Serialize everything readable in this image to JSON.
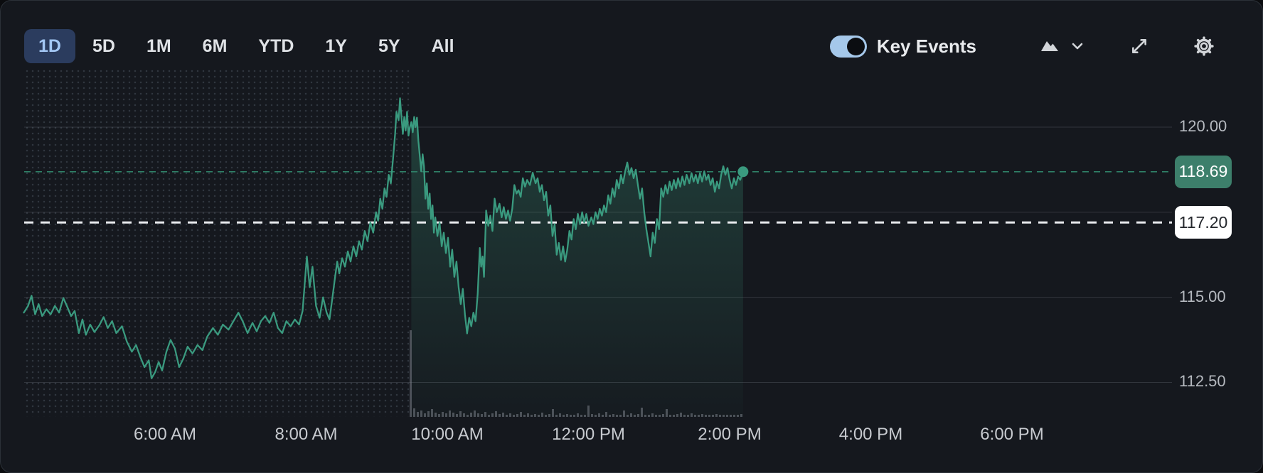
{
  "toolbar": {
    "ranges": [
      "1D",
      "5D",
      "1M",
      "6M",
      "YTD",
      "1Y",
      "5Y",
      "All"
    ],
    "active_range": "1D",
    "active_index": 0
  },
  "controls": {
    "key_events_label": "Key Events",
    "key_events_on": true,
    "icons": {
      "chart_type": "area-chart-icon",
      "chart_type_menu": "chevron-down-icon",
      "fullscreen": "expand-icon",
      "settings": "gear-icon"
    }
  },
  "colors": {
    "background": "#15181e",
    "line_green": "#3a9a7f",
    "current_badge_green": "#3d7f6b",
    "prev_close_badge": "#ffffff",
    "tab_active_bg": "#2b3c5e",
    "tab_active_text": "#a3c7f4",
    "toggle_blue": "#a5c8ea"
  },
  "chart_data": {
    "type": "line",
    "title": "Intraday price chart (1D) with pre-market session",
    "xlabel": "",
    "ylabel": "",
    "x_ticks": [
      {
        "t": 6,
        "label": "6:00 AM"
      },
      {
        "t": 8,
        "label": "8:00 AM"
      },
      {
        "t": 10,
        "label": "10:00 AM"
      },
      {
        "t": 12,
        "label": "12:00 PM"
      },
      {
        "t": 14,
        "label": "2:00 PM"
      },
      {
        "t": 16,
        "label": "4:00 PM"
      },
      {
        "t": 18,
        "label": "6:00 PM"
      }
    ],
    "y_ticks": [
      {
        "v": 120,
        "label": "120.00"
      },
      {
        "v": 115,
        "label": "115.00"
      },
      {
        "v": 112.5,
        "label": "112.50"
      }
    ],
    "gridlines": [
      120,
      117.5,
      115,
      112.5
    ],
    "ylim": [
      111.9,
      121.5
    ],
    "xlim_hours": [
      4.0,
      18.6
    ],
    "session_open_t": 9.5,
    "current_price": 118.69,
    "current_price_label": "118.69",
    "prev_close": 117.2,
    "prev_close_label": "117.20",
    "series": [
      [
        4.0,
        114.55
      ],
      [
        4.06,
        114.75
      ],
      [
        4.11,
        115.05
      ],
      [
        4.16,
        114.5
      ],
      [
        4.21,
        114.8
      ],
      [
        4.26,
        114.45
      ],
      [
        4.32,
        114.65
      ],
      [
        4.38,
        114.5
      ],
      [
        4.44,
        114.75
      ],
      [
        4.5,
        114.55
      ],
      [
        4.56,
        114.98
      ],
      [
        4.62,
        114.7
      ],
      [
        4.67,
        114.45
      ],
      [
        4.72,
        114.6
      ],
      [
        4.78,
        113.95
      ],
      [
        4.83,
        114.35
      ],
      [
        4.88,
        113.9
      ],
      [
        4.94,
        114.2
      ],
      [
        5.0,
        113.98
      ],
      [
        5.07,
        114.18
      ],
      [
        5.13,
        114.42
      ],
      [
        5.19,
        114.1
      ],
      [
        5.25,
        114.3
      ],
      [
        5.31,
        113.95
      ],
      [
        5.39,
        114.15
      ],
      [
        5.46,
        113.7
      ],
      [
        5.53,
        113.4
      ],
      [
        5.59,
        113.6
      ],
      [
        5.65,
        113.25
      ],
      [
        5.71,
        112.95
      ],
      [
        5.77,
        113.15
      ],
      [
        5.81,
        112.62
      ],
      [
        5.86,
        112.8
      ],
      [
        5.91,
        113.1
      ],
      [
        5.96,
        112.85
      ],
      [
        6.02,
        113.4
      ],
      [
        6.08,
        113.75
      ],
      [
        6.14,
        113.5
      ],
      [
        6.2,
        112.95
      ],
      [
        6.26,
        113.2
      ],
      [
        6.32,
        113.55
      ],
      [
        6.39,
        113.35
      ],
      [
        6.46,
        113.6
      ],
      [
        6.53,
        113.45
      ],
      [
        6.6,
        113.85
      ],
      [
        6.68,
        114.1
      ],
      [
        6.75,
        113.9
      ],
      [
        6.82,
        114.2
      ],
      [
        6.9,
        114.05
      ],
      [
        6.97,
        114.3
      ],
      [
        7.04,
        114.55
      ],
      [
        7.1,
        114.3
      ],
      [
        7.17,
        113.95
      ],
      [
        7.24,
        114.25
      ],
      [
        7.3,
        114.0
      ],
      [
        7.36,
        114.3
      ],
      [
        7.42,
        114.45
      ],
      [
        7.48,
        114.25
      ],
      [
        7.54,
        114.55
      ],
      [
        7.6,
        114.1
      ],
      [
        7.66,
        113.95
      ],
      [
        7.72,
        114.3
      ],
      [
        7.78,
        114.15
      ],
      [
        7.84,
        114.35
      ],
      [
        7.9,
        114.2
      ],
      [
        7.95,
        114.6
      ],
      [
        8.01,
        116.2
      ],
      [
        8.05,
        115.3
      ],
      [
        8.09,
        115.9
      ],
      [
        8.14,
        114.75
      ],
      [
        8.19,
        114.4
      ],
      [
        8.24,
        115.0
      ],
      [
        8.29,
        114.55
      ],
      [
        8.33,
        114.35
      ],
      [
        8.37,
        114.95
      ],
      [
        8.41,
        115.6
      ],
      [
        8.44,
        116.05
      ],
      [
        8.47,
        115.7
      ],
      [
        8.51,
        116.15
      ],
      [
        8.55,
        115.9
      ],
      [
        8.59,
        116.35
      ],
      [
        8.63,
        116.05
      ],
      [
        8.67,
        116.5
      ],
      [
        8.71,
        116.2
      ],
      [
        8.75,
        116.65
      ],
      [
        8.79,
        116.4
      ],
      [
        8.83,
        116.95
      ],
      [
        8.87,
        116.65
      ],
      [
        8.91,
        117.2
      ],
      [
        8.95,
        116.9
      ],
      [
        8.99,
        117.5
      ],
      [
        9.02,
        117.25
      ],
      [
        9.05,
        117.9
      ],
      [
        9.08,
        117.6
      ],
      [
        9.11,
        118.2
      ],
      [
        9.14,
        117.95
      ],
      [
        9.17,
        118.6
      ],
      [
        9.2,
        118.35
      ],
      [
        9.23,
        119.05
      ],
      [
        9.26,
        119.8
      ],
      [
        9.28,
        120.45
      ],
      [
        9.31,
        120.2
      ],
      [
        9.33,
        120.85
      ],
      [
        9.35,
        120.3
      ],
      [
        9.37,
        119.8
      ],
      [
        9.39,
        120.3
      ],
      [
        9.41,
        119.9
      ],
      [
        9.43,
        120.45
      ],
      [
        9.45,
        119.75
      ],
      [
        9.47,
        120.0
      ],
      [
        9.49,
        120.15
      ],
      [
        9.51,
        119.85
      ],
      [
        9.53,
        120.3
      ],
      [
        9.55,
        120.0
      ],
      [
        9.57,
        120.28
      ],
      [
        9.59,
        119.6
      ],
      [
        9.61,
        119.15
      ],
      [
        9.63,
        118.7
      ],
      [
        9.65,
        119.2
      ],
      [
        9.67,
        118.85
      ],
      [
        9.69,
        117.9
      ],
      [
        9.71,
        118.35
      ],
      [
        9.73,
        117.6
      ],
      [
        9.75,
        118.05
      ],
      [
        9.77,
        117.3
      ],
      [
        9.79,
        117.7
      ],
      [
        9.81,
        116.9
      ],
      [
        9.83,
        117.35
      ],
      [
        9.86,
        116.8
      ],
      [
        9.89,
        117.2
      ],
      [
        9.92,
        116.5
      ],
      [
        9.95,
        116.9
      ],
      [
        9.98,
        116.3
      ],
      [
        10.01,
        116.75
      ],
      [
        10.04,
        115.9
      ],
      [
        10.07,
        116.4
      ],
      [
        10.1,
        115.6
      ],
      [
        10.13,
        116.05
      ],
      [
        10.16,
        115.3
      ],
      [
        10.19,
        114.8
      ],
      [
        10.22,
        115.25
      ],
      [
        10.25,
        114.5
      ],
      [
        10.28,
        113.94
      ],
      [
        10.31,
        114.4
      ],
      [
        10.34,
        114.15
      ],
      [
        10.37,
        114.55
      ],
      [
        10.4,
        114.3
      ],
      [
        10.43,
        115.1
      ],
      [
        10.46,
        116.45
      ],
      [
        10.48,
        115.9
      ],
      [
        10.5,
        116.2
      ],
      [
        10.52,
        115.6
      ],
      [
        10.55,
        117.55
      ],
      [
        10.58,
        117.1
      ],
      [
        10.61,
        117.4
      ],
      [
        10.64,
        116.95
      ],
      [
        10.67,
        117.9
      ],
      [
        10.7,
        117.5
      ],
      [
        10.74,
        117.75
      ],
      [
        10.77,
        117.35
      ],
      [
        10.8,
        117.65
      ],
      [
        10.83,
        117.3
      ],
      [
        10.86,
        117.55
      ],
      [
        10.89,
        117.25
      ],
      [
        10.92,
        117.6
      ],
      [
        10.95,
        118.3
      ],
      [
        10.98,
        118.05
      ],
      [
        11.01,
        118.15
      ],
      [
        11.04,
        117.95
      ],
      [
        11.07,
        118.5
      ],
      [
        11.1,
        118.25
      ],
      [
        11.13,
        118.45
      ],
      [
        11.17,
        118.3
      ],
      [
        11.21,
        118.66
      ],
      [
        11.25,
        118.35
      ],
      [
        11.28,
        118.5
      ],
      [
        11.31,
        118.1
      ],
      [
        11.34,
        118.3
      ],
      [
        11.37,
        117.85
      ],
      [
        11.4,
        118.1
      ],
      [
        11.43,
        117.4
      ],
      [
        11.46,
        117.7
      ],
      [
        11.49,
        116.8
      ],
      [
        11.52,
        117.15
      ],
      [
        11.55,
        116.25
      ],
      [
        11.58,
        116.6
      ],
      [
        11.61,
        116.1
      ],
      [
        11.64,
        116.5
      ],
      [
        11.67,
        116.05
      ],
      [
        11.7,
        116.4
      ],
      [
        11.73,
        116.95
      ],
      [
        11.76,
        116.7
      ],
      [
        11.79,
        117.3
      ],
      [
        11.82,
        117.0
      ],
      [
        11.85,
        117.45
      ],
      [
        11.88,
        117.15
      ],
      [
        11.91,
        117.5
      ],
      [
        11.94,
        117.2
      ],
      [
        11.97,
        117.45
      ],
      [
        12.0,
        117.1
      ],
      [
        12.04,
        117.35
      ],
      [
        12.07,
        117.15
      ],
      [
        12.1,
        117.5
      ],
      [
        12.13,
        117.3
      ],
      [
        12.16,
        117.6
      ],
      [
        12.19,
        117.4
      ],
      [
        12.22,
        117.7
      ],
      [
        12.25,
        117.5
      ],
      [
        12.28,
        118.0
      ],
      [
        12.31,
        117.75
      ],
      [
        12.34,
        118.2
      ],
      [
        12.37,
        117.95
      ],
      [
        12.4,
        118.45
      ],
      [
        12.43,
        118.2
      ],
      [
        12.46,
        118.6
      ],
      [
        12.49,
        118.35
      ],
      [
        12.52,
        118.7
      ],
      [
        12.55,
        118.96
      ],
      [
        12.58,
        118.6
      ],
      [
        12.61,
        118.8
      ],
      [
        12.64,
        118.5
      ],
      [
        12.67,
        118.75
      ],
      [
        12.7,
        118.3
      ],
      [
        12.73,
        117.9
      ],
      [
        12.76,
        118.2
      ],
      [
        12.79,
        117.5
      ],
      [
        12.82,
        117.0
      ],
      [
        12.85,
        116.6
      ],
      [
        12.88,
        116.2
      ],
      [
        12.91,
        116.9
      ],
      [
        12.94,
        116.6
      ],
      [
        12.97,
        117.3
      ],
      [
        13.0,
        117.0
      ],
      [
        13.03,
        118.2
      ],
      [
        13.06,
        117.95
      ],
      [
        13.09,
        118.3
      ],
      [
        13.12,
        118.05
      ],
      [
        13.15,
        118.4
      ],
      [
        13.18,
        118.15
      ],
      [
        13.21,
        118.45
      ],
      [
        13.24,
        118.2
      ],
      [
        13.27,
        118.5
      ],
      [
        13.3,
        118.25
      ],
      [
        13.33,
        118.55
      ],
      [
        13.36,
        118.3
      ],
      [
        13.39,
        118.6
      ],
      [
        13.43,
        118.35
      ],
      [
        13.46,
        118.65
      ],
      [
        13.49,
        118.4
      ],
      [
        13.52,
        118.6
      ],
      [
        13.55,
        118.35
      ],
      [
        13.58,
        118.65
      ],
      [
        13.61,
        118.4
      ],
      [
        13.64,
        118.7
      ],
      [
        13.67,
        118.45
      ],
      [
        13.7,
        118.6
      ],
      [
        13.73,
        118.3
      ],
      [
        13.76,
        118.5
      ],
      [
        13.79,
        118.1
      ],
      [
        13.82,
        118.4
      ],
      [
        13.85,
        118.2
      ],
      [
        13.88,
        118.6
      ],
      [
        13.91,
        118.85
      ],
      [
        13.94,
        118.6
      ],
      [
        13.97,
        118.8
      ],
      [
        14.0,
        118.45
      ],
      [
        14.03,
        118.2
      ],
      [
        14.06,
        118.5
      ],
      [
        14.09,
        118.3
      ],
      [
        14.12,
        118.55
      ],
      [
        14.15,
        118.45
      ],
      [
        14.19,
        118.69
      ]
    ],
    "volume": [
      122,
      12,
      7,
      9,
      5,
      8,
      11,
      6,
      4,
      7,
      5,
      9,
      6,
      4,
      8,
      5,
      3,
      6,
      9,
      5,
      4,
      7,
      3,
      5,
      8,
      4,
      6,
      3,
      5,
      3,
      4,
      7,
      3,
      5,
      3,
      4,
      3,
      6,
      3,
      4,
      11,
      3,
      5,
      3,
      4,
      3,
      3,
      5,
      3,
      3,
      16,
      4,
      3,
      5,
      3,
      7,
      3,
      4,
      3,
      3,
      9,
      3,
      5,
      3,
      4,
      13,
      3,
      3,
      5,
      3,
      3,
      4,
      11,
      3,
      3,
      4,
      6,
      3,
      3,
      5,
      3,
      3,
      4,
      3,
      3,
      3,
      4,
      3,
      3,
      3,
      3,
      3,
      3,
      4
    ],
    "legend": [],
    "grid_on": true
  }
}
